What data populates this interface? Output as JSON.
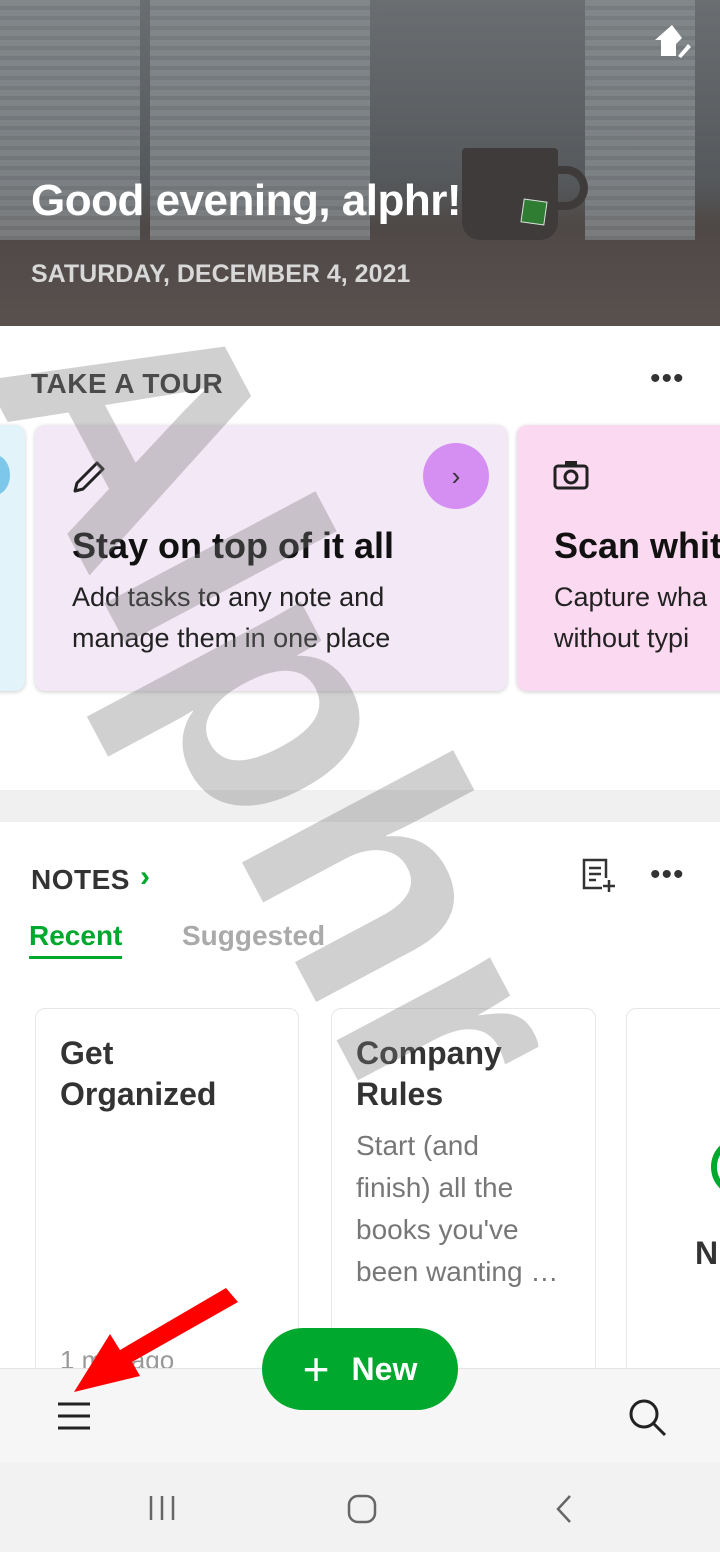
{
  "header": {
    "greeting": "Good evening, alphr!",
    "date": "SATURDAY, DECEMBER 4, 2021",
    "home_icon": "home-edit-icon"
  },
  "tour": {
    "title": "TAKE A TOUR",
    "cards": [
      {
        "icon": "pencil-icon",
        "title": "Stay on top of it all",
        "desc_line1": "Add tasks to any note and",
        "desc_line2": "manage them in one place",
        "bg": "#f3e8f6",
        "arrow_color": "#d58ef2"
      },
      {
        "icon": "camera-icon",
        "title": "Scan whit",
        "desc_line1": "Capture wha",
        "desc_line2": "without typi",
        "bg": "#fbd9f0"
      }
    ]
  },
  "notes": {
    "title": "NOTES",
    "tabs": [
      {
        "label": "Recent",
        "active": true
      },
      {
        "label": "Suggested",
        "active": false
      }
    ],
    "cards": [
      {
        "title_line1": "Get",
        "title_line2": "Organized",
        "time": "1 min ago"
      },
      {
        "title_line1": "Company",
        "title_line2": "Rules",
        "body": [
          "Start (and",
          "finish) all the",
          "books you've",
          "been wanting …"
        ]
      },
      {
        "title_line1": "N"
      }
    ]
  },
  "bottom": {
    "new_label": "New"
  },
  "accent": "#00a82d",
  "watermark": "Alphr"
}
